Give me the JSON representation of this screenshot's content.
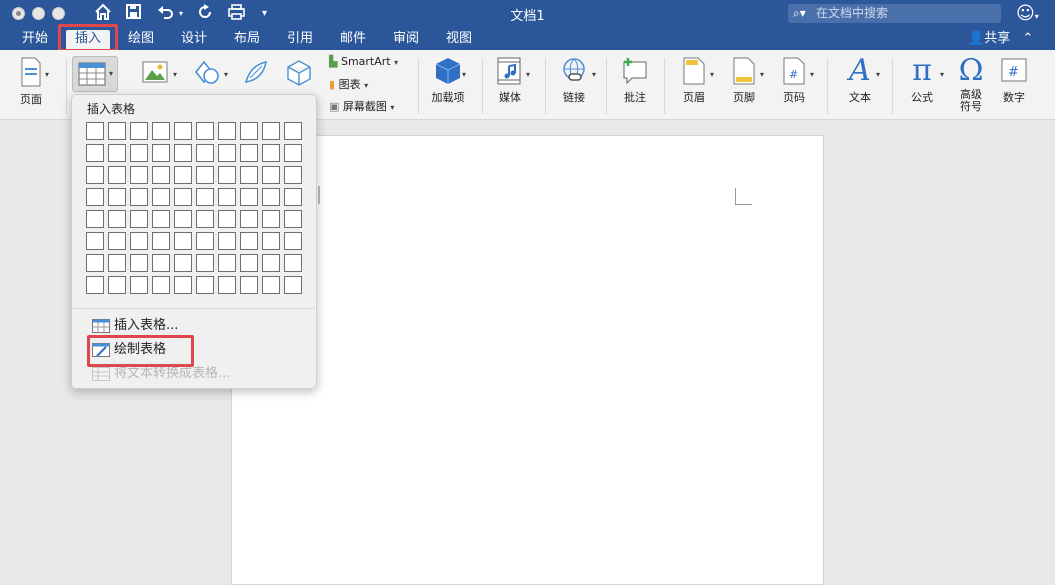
{
  "window": {
    "title": "文档1",
    "search_placeholder": "在文档中搜索",
    "share_label": "共享"
  },
  "tabs": [
    {
      "label": "开始"
    },
    {
      "label": "插入",
      "active": true
    },
    {
      "label": "绘图"
    },
    {
      "label": "设计"
    },
    {
      "label": "布局"
    },
    {
      "label": "引用"
    },
    {
      "label": "邮件"
    },
    {
      "label": "审阅"
    },
    {
      "label": "视图"
    }
  ],
  "ribbon": {
    "page": "页面",
    "smartart": "SmartArt",
    "chart": "图表",
    "screenshot": "屏幕截图",
    "addins": "加载项",
    "media": "媒体",
    "link": "链接",
    "comment": "批注",
    "header": "页眉",
    "footer": "页脚",
    "page_number": "页码",
    "text": "文本",
    "equation": "公式",
    "symbol_line1": "高级",
    "symbol_line2": "符号",
    "number": "数字"
  },
  "dropdown": {
    "title": "插入表格",
    "grid_cols": 10,
    "grid_rows": 8,
    "insert_table": "插入表格...",
    "draw_table": "绘制表格",
    "text_to_table": "将文本转换成表格..."
  },
  "colors": {
    "title_bar": "#2b579a",
    "highlight": "#e0474c",
    "accent_blue": "#2b579a"
  }
}
